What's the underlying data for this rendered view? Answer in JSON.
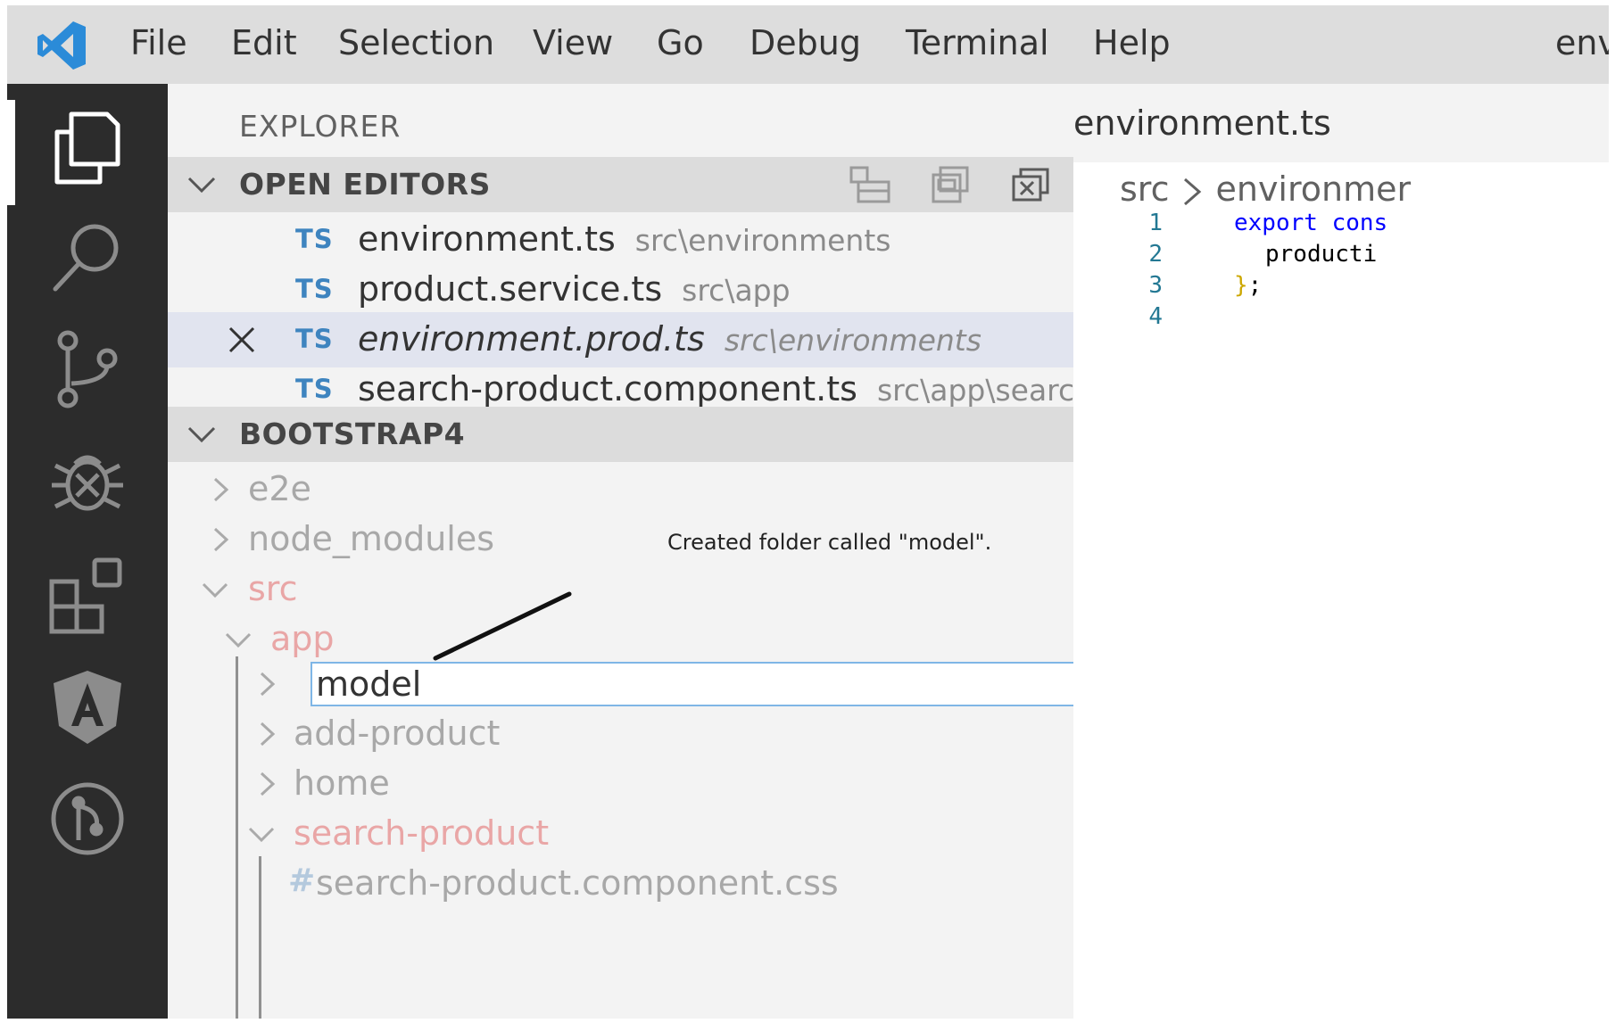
{
  "menubar": {
    "items": [
      "File",
      "Edit",
      "Selection",
      "View",
      "Go",
      "Debug",
      "Terminal",
      "Help"
    ],
    "window_title": "env"
  },
  "sidebar": {
    "title": "EXPLORER",
    "open_editors": {
      "title": "OPEN EDITORS",
      "items": [
        {
          "badge": "TS",
          "name": "environment.ts",
          "path": "src\\environments"
        },
        {
          "badge": "TS",
          "name": "product.service.ts",
          "path": "src\\app"
        },
        {
          "badge": "TS",
          "name": "environment.prod.ts",
          "path": "src\\environments"
        },
        {
          "badge": "TS",
          "name": "search-product.component.ts",
          "path": "src\\app\\search-..."
        }
      ]
    },
    "project": {
      "title": "BOOTSTRAP4",
      "tree": {
        "e2e": "e2e",
        "node_modules": "node_modules",
        "src": "src",
        "app": "app",
        "rename_value": "model",
        "add_product": "add-product",
        "home": "home",
        "search_product": "search-product",
        "css_badge": "#",
        "css_file": "search-product.component.css"
      }
    }
  },
  "notification": "Created folder called \"model\".",
  "editor": {
    "tab_label": "environment.ts",
    "breadcrumb": [
      "src",
      "environmer"
    ],
    "lines": [
      {
        "num": "1",
        "keyword": "export",
        "rest": "cons"
      },
      {
        "num": "2",
        "text": "producti"
      },
      {
        "num": "3",
        "brace": "}",
        "rest": ";"
      },
      {
        "num": "4",
        "text": ""
      }
    ]
  },
  "colors": {
    "activity_bar": "#2c2c2c",
    "menubar": "#dddddd",
    "sidebar": "#f3f3f3",
    "ts_badge": "#3e84bf",
    "modified": "#e9a6a6",
    "accent_focus": "#7fb6e6"
  }
}
